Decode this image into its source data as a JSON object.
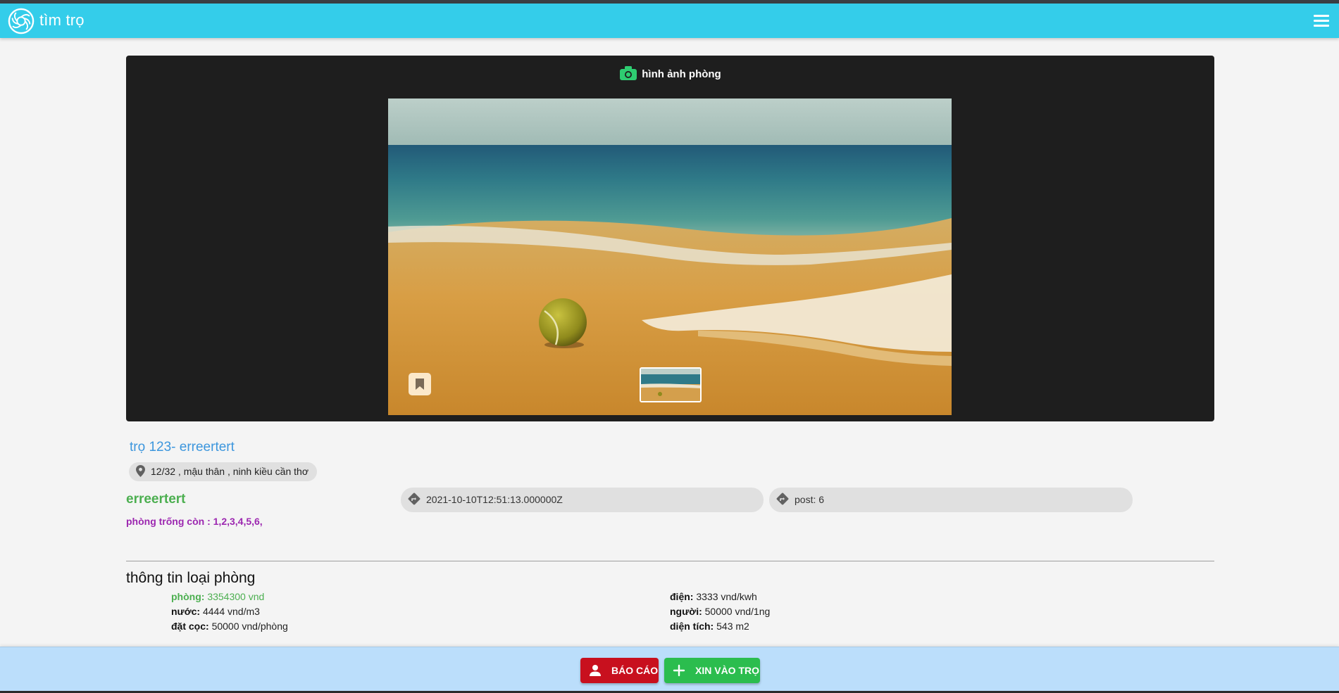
{
  "header": {
    "brand": "tìm trọ",
    "logo_icon": "aperture-logo-icon",
    "menu_icon": "hamburger-menu-icon",
    "bar_color": "#34cdea"
  },
  "gallery": {
    "heading": "hình ảnh phòng",
    "heading_icon": "camera-icon",
    "heading_icon_color": "#2ecc71",
    "bookmark_icon": "bookmark-icon"
  },
  "listing": {
    "title": "trọ 123- erreertert",
    "address": "12/32 , mậu thân , ninh kiều cần thơ",
    "owner": "erreertert",
    "rooms_label": "phòng trống còn :",
    "rooms_value": "1,2,3,4,5,6,",
    "created_at": "2021-10-10T12:51:13.000000Z",
    "post": "post: 6"
  },
  "room_type": {
    "heading": "thông tin loại phòng",
    "room_price": {
      "label": "phòng:",
      "value": "3354300 vnd"
    },
    "water": {
      "label": "nước:",
      "value": "4444 vnd/m3"
    },
    "deposit": {
      "label": "đặt cọc:",
      "value": "50000 vnd/phòng"
    },
    "electricity": {
      "label": "điện:",
      "value": "3333 vnd/kwh"
    },
    "per_person": {
      "label": "người:",
      "value": "50000 vnd/1ng"
    },
    "area": {
      "label": "diện tích:",
      "value": "543 m2"
    }
  },
  "footer": {
    "report_label": "BÁO CÁO",
    "report_icon": "person-icon",
    "report_color": "#c8101e",
    "join_label": "XIN VÀO TRỌ",
    "join_icon": "plus-icon",
    "join_color": "#2bbd4e"
  }
}
